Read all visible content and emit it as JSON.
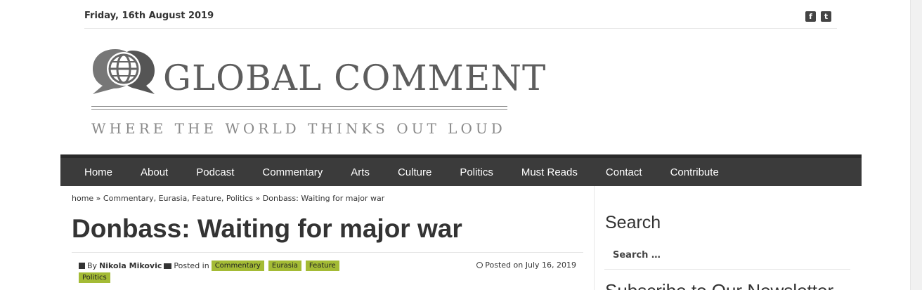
{
  "topbar": {
    "date": "Friday, 16th August 2019",
    "social": [
      {
        "icon": "facebook-icon",
        "glyph": "f"
      },
      {
        "icon": "twitter-icon",
        "glyph": "t"
      }
    ]
  },
  "logo": {
    "name": "GLOBAL COMMENT",
    "tagline": "WHERE THE WORLD THINKS OUT LOUD"
  },
  "nav": {
    "items": [
      "Home",
      "About",
      "Podcast",
      "Commentary",
      "Arts",
      "Culture",
      "Politics",
      "Must Reads",
      "Contact",
      "Contribute"
    ]
  },
  "article": {
    "breadcrumb": "home » Commentary, Eurasia, Feature, Politics » Donbass: Waiting for major war",
    "title": "Donbass: Waiting for major war",
    "by_label": "By",
    "author": "Nikola Mikovic",
    "posted_in_label": "Posted in",
    "categories": [
      "Commentary",
      "Eurasia",
      "Feature",
      "Politics"
    ],
    "posted_on": "Posted on July 16, 2019"
  },
  "sidebar": {
    "search_title": "Search",
    "search_placeholder": "Search …",
    "next_title": "Subscribe to Our Newsletter"
  },
  "colors": {
    "nav_bg": "#3b3b3b",
    "tag_bg": "#a4bb35"
  }
}
